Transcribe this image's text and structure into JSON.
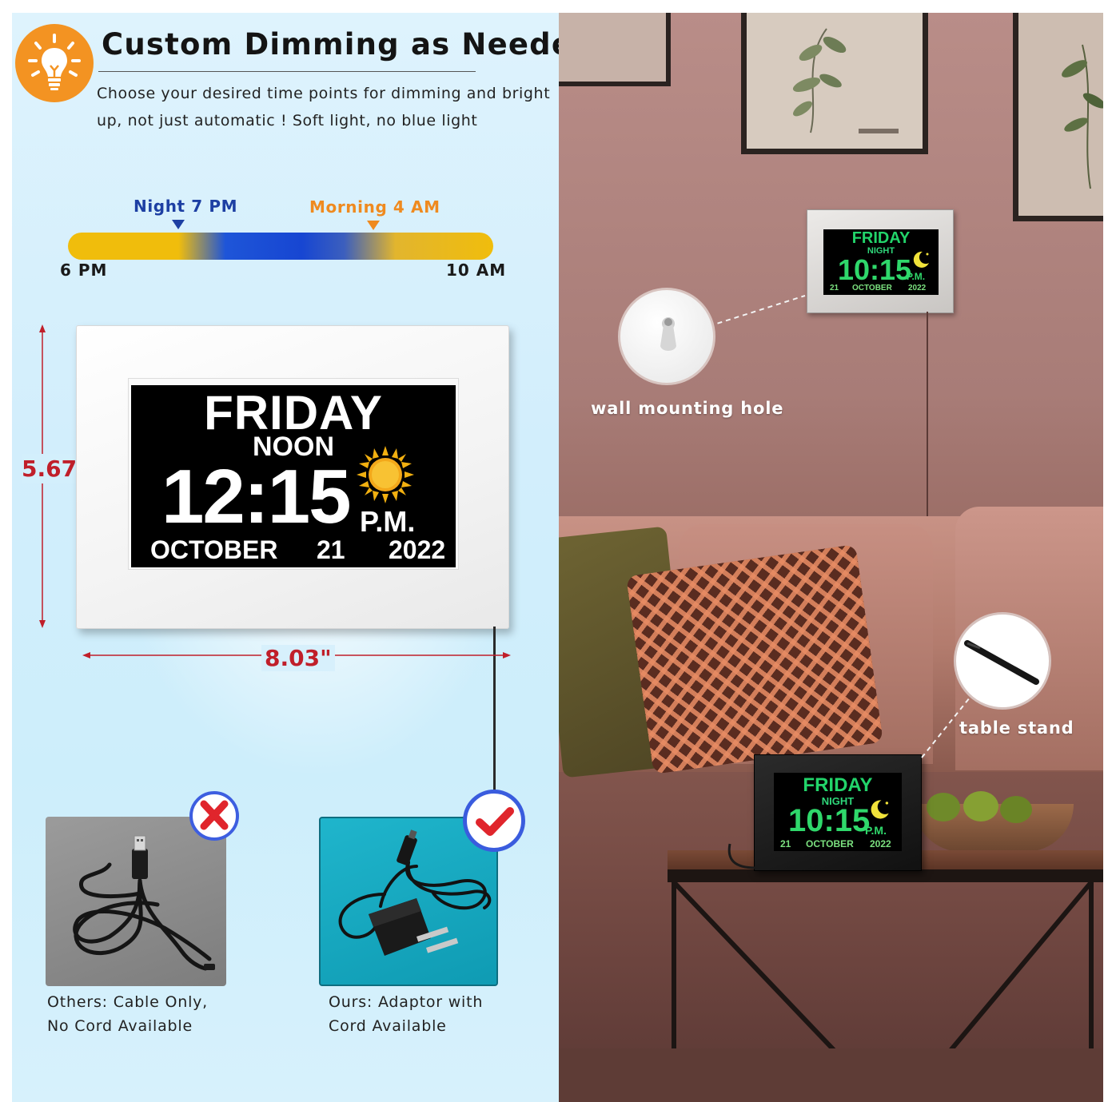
{
  "heading": {
    "title": "Custom Dimming as Needed",
    "line1": "Choose your desired time points for dimming and bright",
    "line2": "up, not just automatic ! Soft light, no blue light"
  },
  "schedule": {
    "night_label": "Night 7 PM",
    "morning_label": "Morning 4 AM",
    "start_label": "6 PM",
    "end_label": "10 AM",
    "colors": {
      "night": "#1d3fa3",
      "morning": "#ef8a1f",
      "day_bar": "#f0bd0c",
      "night_bar": "#1746d2"
    }
  },
  "main_clock": {
    "day": "FRIDAY",
    "period": "NOON",
    "time": "12:15",
    "ampm": "P.M.",
    "month": "OCTOBER",
    "date": "21",
    "year": "2022",
    "icon": "sun-icon"
  },
  "dimensions": {
    "height": "5.67\"",
    "width": "8.03\"",
    "color": "#c01f2a"
  },
  "accessories": {
    "others": {
      "line1": "Others: Cable Only,",
      "line2": "No Cord Available",
      "mark_icon": "x-mark-icon"
    },
    "ours": {
      "line1": "Ours: Adaptor with",
      "line2": "Cord Available",
      "mark_icon": "check-mark-icon"
    }
  },
  "room": {
    "wall_mount_label": "wall mounting hole",
    "table_stand_label": "table stand",
    "wall_clock": {
      "day": "FRIDAY",
      "period": "NIGHT",
      "time": "10:15",
      "ampm": "P.M.",
      "date": "21",
      "month": "OCTOBER",
      "year": "2022",
      "icon": "moon-icon"
    },
    "table_clock": {
      "day": "FRIDAY",
      "period": "NIGHT",
      "time": "10:15",
      "ampm": "P.M.",
      "date": "21",
      "month": "OCTOBER",
      "year": "2022",
      "icon": "moon-icon"
    },
    "night_colors": {
      "day_text": "#22d46a",
      "date_text": "#7be07f",
      "moon": "#f1e23a"
    }
  }
}
